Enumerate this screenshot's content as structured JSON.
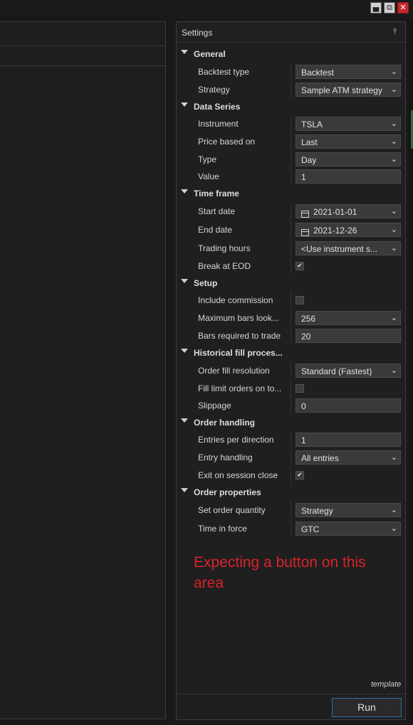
{
  "window": {
    "minimize": "▄",
    "restore": "⧉",
    "close": "✕"
  },
  "settings": {
    "title": "Settings",
    "pin": "⫯",
    "note": "Expecting a button on this area",
    "template_label": "template",
    "run_label": "Run",
    "rows": [
      {
        "kind": "cat",
        "label": "General"
      },
      {
        "kind": "prop",
        "label": "Backtest type",
        "type": "combo",
        "value": "Backtest"
      },
      {
        "kind": "prop",
        "label": "Strategy",
        "type": "combo",
        "value": "Sample ATM strategy"
      },
      {
        "kind": "cat",
        "label": "Data Series"
      },
      {
        "kind": "prop",
        "label": "Instrument",
        "type": "combo",
        "value": "TSLA"
      },
      {
        "kind": "prop",
        "label": "Price based on",
        "type": "combo",
        "value": "Last"
      },
      {
        "kind": "prop",
        "label": "Type",
        "type": "combo",
        "value": "Day"
      },
      {
        "kind": "prop",
        "label": "Value",
        "type": "text",
        "value": "1"
      },
      {
        "kind": "cat",
        "label": "Time frame"
      },
      {
        "kind": "prop",
        "label": "Start date",
        "type": "date",
        "value": "2021-01-01"
      },
      {
        "kind": "prop",
        "label": "End date",
        "type": "date",
        "value": "2021-12-26"
      },
      {
        "kind": "prop",
        "label": "Trading hours",
        "type": "combo",
        "value": "<Use instrument s..."
      },
      {
        "kind": "prop",
        "label": "Break at EOD",
        "type": "check",
        "checked": true
      },
      {
        "kind": "cat",
        "label": "Setup"
      },
      {
        "kind": "prop",
        "label": "Include commission",
        "type": "check",
        "checked": false
      },
      {
        "kind": "prop",
        "label": "Maximum bars look...",
        "type": "combo",
        "value": "256"
      },
      {
        "kind": "prop",
        "label": "Bars required to trade",
        "type": "text",
        "value": "20"
      },
      {
        "kind": "cat",
        "label": "Historical fill proces..."
      },
      {
        "kind": "prop",
        "label": "Order fill resolution",
        "type": "combo",
        "value": "Standard (Fastest)"
      },
      {
        "kind": "prop",
        "label": "Fill limit orders on to...",
        "type": "check",
        "checked": false
      },
      {
        "kind": "prop",
        "label": "Slippage",
        "type": "text",
        "value": "0"
      },
      {
        "kind": "cat",
        "label": "Order handling"
      },
      {
        "kind": "prop",
        "label": "Entries per direction",
        "type": "text",
        "value": "1"
      },
      {
        "kind": "prop",
        "label": "Entry handling",
        "type": "combo",
        "value": "All entries"
      },
      {
        "kind": "prop",
        "label": "Exit on session close",
        "type": "check",
        "checked": true
      },
      {
        "kind": "cat",
        "label": "Order properties"
      },
      {
        "kind": "prop",
        "label": "Set order quantity",
        "type": "combo",
        "value": "Strategy"
      },
      {
        "kind": "prop",
        "label": "Time in force",
        "type": "combo",
        "value": "GTC"
      }
    ]
  }
}
